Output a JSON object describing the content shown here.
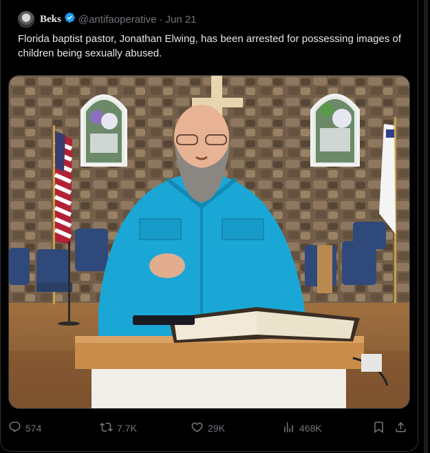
{
  "tweet": {
    "display_name": "Beks",
    "verified": true,
    "handle": "@antifaoperative",
    "separator": "·",
    "date": "Jun 21",
    "text": "Florida baptist pastor, Jonathan Elwing, has been arrested for possessing images of children being sexually abused."
  },
  "media": {
    "icon": "photo-of-pastor-at-pulpit"
  },
  "actions": {
    "reply_count": "574",
    "repost_count": "7.7K",
    "like_count": "29K",
    "views_count": "468K",
    "icons": [
      "reply-icon",
      "repost-icon",
      "like-icon",
      "views-icon",
      "bookmark-icon",
      "share-icon"
    ]
  },
  "colors": {
    "background": "#000000",
    "text_primary": "#e7e9ea",
    "text_secondary": "#71767b",
    "verified_blue": "#1d9bf0",
    "border": "#2f3336"
  }
}
